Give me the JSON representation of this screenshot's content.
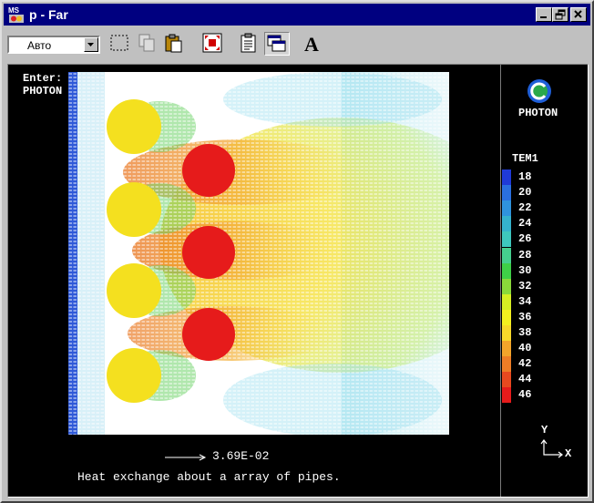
{
  "window": {
    "app_icon": "ms-dos-icon",
    "title": "p - Far",
    "controls": [
      "minimize-icon",
      "restore-icon",
      "close-icon"
    ]
  },
  "toolbar": {
    "font_size_select": {
      "value": "Авто"
    },
    "tools": [
      {
        "name": "mark-tool-icon",
        "pressed": false
      },
      {
        "name": "copy-icon",
        "pressed": false
      },
      {
        "name": "paste-icon",
        "pressed": false
      },
      {
        "name": "fullscreen-icon",
        "pressed": false
      },
      {
        "name": "properties-icon",
        "pressed": false
      },
      {
        "name": "background-icon",
        "pressed": true
      },
      {
        "name": "font-icon",
        "pressed": false,
        "label": "A"
      }
    ]
  },
  "screen": {
    "prompt_lines": [
      "Enter:",
      "PHOTON"
    ],
    "logo_text": "PHOTON",
    "legend": {
      "title": "TEM1",
      "levels": [
        {
          "label": "18",
          "color": "#1f3ad8"
        },
        {
          "label": "20",
          "color": "#2a6fe0"
        },
        {
          "label": "22",
          "color": "#2f93dc"
        },
        {
          "label": "24",
          "color": "#35b2cc"
        },
        {
          "label": "26",
          "color": "#3ec7bd"
        },
        {
          "label": "28",
          "color": "#45cf8e"
        },
        {
          "label": "30",
          "color": "#3fcf47"
        },
        {
          "label": "32",
          "color": "#8ad93a"
        },
        {
          "label": "34",
          "color": "#d6ee23"
        },
        {
          "label": "36",
          "color": "#f4f01f"
        },
        {
          "label": "38",
          "color": "#f7d82a"
        },
        {
          "label": "40",
          "color": "#f3a42a"
        },
        {
          "label": "42",
          "color": "#ee7d26"
        },
        {
          "label": "44",
          "color": "#e8491f"
        },
        {
          "label": "46",
          "color": "#e61b1b"
        }
      ]
    },
    "axes": {
      "y": "Y",
      "x": "X"
    },
    "vector_scale": "3.69E-02",
    "caption": "Heat exchange about a array of pipes."
  }
}
